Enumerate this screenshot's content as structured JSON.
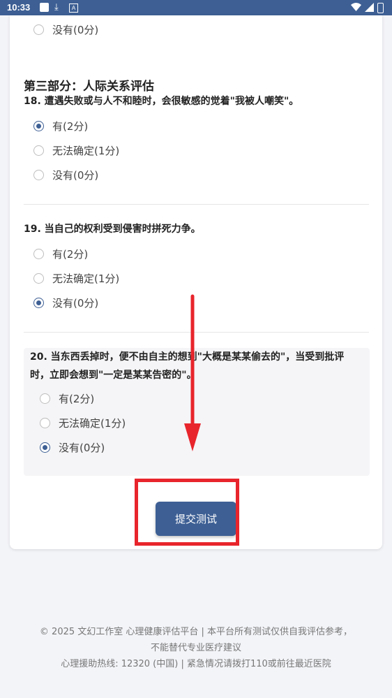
{
  "status_bar": {
    "time": "10:33",
    "icons": [
      "notification-square-icon",
      "download-icon",
      "app-a-icon",
      "wifi-icon",
      "cellular-icon",
      "battery-icon"
    ]
  },
  "prev_option": {
    "label": "没有(0分)",
    "checked": false
  },
  "section": {
    "title": "第三部分：人际关系评估"
  },
  "questions": [
    {
      "text": "18. 遭遇失败或与人不和睦时，会很敏感的觉着\"我被人嘲笑\"。",
      "options": [
        {
          "label": "有(2分)",
          "checked": true
        },
        {
          "label": "无法确定(1分)",
          "checked": false
        },
        {
          "label": "没有(0分)",
          "checked": false
        }
      ]
    },
    {
      "text": "19. 当自己的权利受到侵害时拼死力争。",
      "options": [
        {
          "label": "有(2分)",
          "checked": false
        },
        {
          "label": "无法确定(1分)",
          "checked": false
        },
        {
          "label": "没有(0分)",
          "checked": true
        }
      ]
    },
    {
      "text_line1": "20. 当东西丢掉时，便不由自主的想到\"大概是某某偷去的\"，当受到批评",
      "text_line2": "时，立即会想到\"一定是某某告密的\"。",
      "options": [
        {
          "label": "有(2分)",
          "checked": false
        },
        {
          "label": "无法确定(1分)",
          "checked": false
        },
        {
          "label": "没有(0分)",
          "checked": true
        }
      ]
    }
  ],
  "submit": {
    "label": "提交测试"
  },
  "footer": {
    "line1": "© 2025 文幻工作室 心理健康评估平台 | 本平台所有测试仅供自我评估参考，",
    "line2": "不能替代专业医疗建议",
    "line3": "心理援助热线: 12320 (中国) | 紧急情况请拨打110或前往最近医院"
  },
  "colors": {
    "accent": "#3d5f94",
    "annotation_red": "#e8252c"
  }
}
